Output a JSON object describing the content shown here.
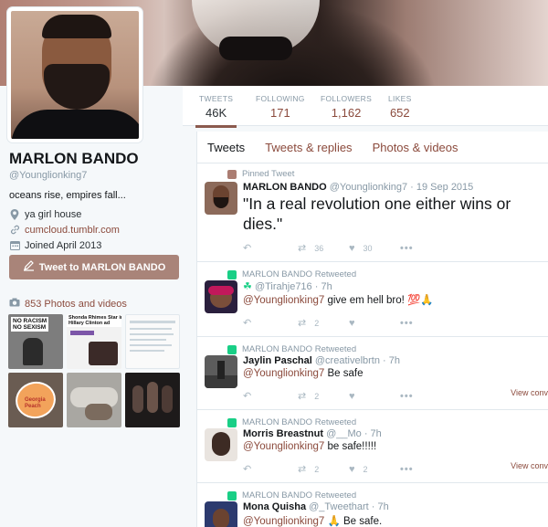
{
  "profile": {
    "name": "MARLON BANDO",
    "handle": "@Younglionking7",
    "bio": "oceans rise, empires fall...",
    "location": "ya girl house",
    "website": "cumcloud.tumblr.com",
    "joined": "Joined April 2013",
    "tweet_to_label": "Tweet to MARLON BANDO",
    "photos_label": "853 Photos and videos"
  },
  "stats": [
    {
      "label": "TWEETS",
      "value": "46K"
    },
    {
      "label": "FOLLOWING",
      "value": "171"
    },
    {
      "label": "FOLLOWERS",
      "value": "1,162"
    },
    {
      "label": "LIKES",
      "value": "652"
    }
  ],
  "tabs": [
    "Tweets",
    "Tweets & replies",
    "Photos & videos"
  ],
  "thumbs": [
    {
      "text": "NO RACISM\nNO SEXISM"
    },
    {
      "text": "Shonda Rhimes Star in\nHillary Clinton ad"
    },
    {
      "text": ""
    },
    {
      "text": "Georgia Peach"
    },
    {
      "text": ""
    },
    {
      "text": ""
    }
  ],
  "tweets": [
    {
      "context": "Pinned Tweet",
      "name": "MARLON BANDO",
      "handle": "@Younglionking7 · 19 Sep 2015",
      "text": "\"In a real revolution one either wins or dies.\"",
      "retweets": "36",
      "likes": "30",
      "view_conversation": ""
    },
    {
      "context": "MARLON BANDO Retweeted",
      "name": "☘",
      "handle": "@Tirahje716 · 7h",
      "mention": "@Younglionking7",
      "text": " give em hell bro! 💯🙏",
      "retweets": "2",
      "likes": "",
      "view_conversation": ""
    },
    {
      "context": "MARLON BANDO Retweeted",
      "name": "Jaylin Paschal",
      "handle": "@creativelbrtn · 7h",
      "mention": "@Younglionking7",
      "text": " Be safe",
      "retweets": "2",
      "likes": "",
      "view_conversation": "View conv"
    },
    {
      "context": "MARLON BANDO Retweeted",
      "name": "Morris Breastnut",
      "handle": "@__Mo · 7h",
      "mention": "@Younglionking7",
      "text": " be safe!!!!!",
      "retweets": "2",
      "likes": "2",
      "view_conversation": "View conv"
    },
    {
      "context": "MARLON BANDO Retweeted",
      "name": "Mona Quisha",
      "handle": "@_Tweethart · 7h",
      "mention": "@Younglionking7",
      "text": " 🙏 Be safe.",
      "retweets": "",
      "likes": "",
      "view_conversation": ""
    }
  ],
  "icons": {
    "location": "location-pin-icon",
    "link": "link-icon",
    "calendar": "calendar-icon",
    "camera": "camera-icon",
    "reply": "reply-icon",
    "retweet": "retweet-icon",
    "like": "heart-icon",
    "more": "more-icon"
  },
  "colors": {
    "accent": "#8b4a3c",
    "button": "#a98479",
    "retweet_badge": "#19cf86",
    "pinned_badge": "#ab7d72"
  }
}
